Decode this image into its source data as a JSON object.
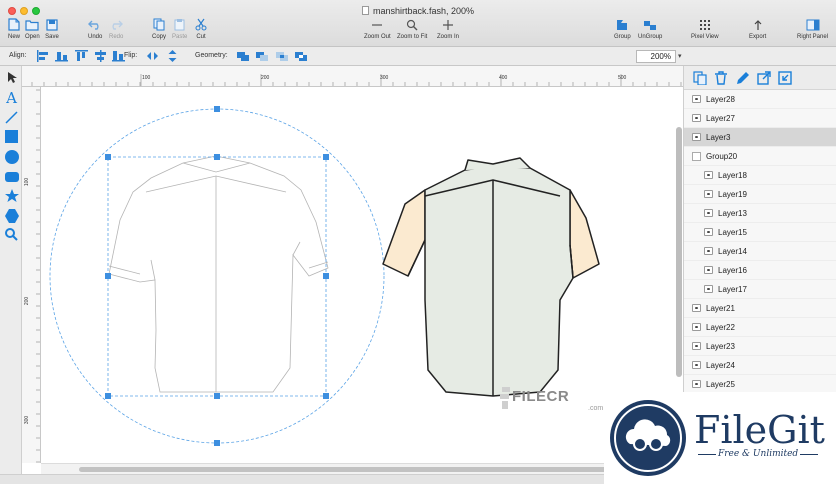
{
  "window": {
    "title": "manshirtback.fash, 200%"
  },
  "toolbar": {
    "new": "New",
    "open": "Open",
    "save": "Save",
    "undo": "Undo",
    "redo": "Redo",
    "copy": "Copy",
    "paste": "Paste",
    "cut": "Cut",
    "zoom_out": "Zoom Out",
    "zoom_to_fit": "Zoom to Fit",
    "zoom_in": "Zoom In",
    "group": "Group",
    "ungroup": "UnGroup",
    "pixel_view": "Pixel View",
    "export": "Export",
    "right_panel": "Right Panel"
  },
  "options": {
    "align_label": "Align:",
    "flip_label": "Flip:",
    "geometry_label": "Geometry:",
    "zoom_value": "200%"
  },
  "rulers": {
    "horizontal": [
      "100",
      "200",
      "300",
      "400",
      "500"
    ],
    "vertical": [
      "100",
      "200",
      "300"
    ]
  },
  "layers": [
    {
      "name": "Layer28",
      "kind": "layer",
      "selected": false
    },
    {
      "name": "Layer27",
      "kind": "layer",
      "selected": false
    },
    {
      "name": "Layer3",
      "kind": "layer",
      "selected": true
    },
    {
      "name": "Group20",
      "kind": "group",
      "selected": false
    },
    {
      "name": "Layer18",
      "kind": "child",
      "selected": false
    },
    {
      "name": "Layer19",
      "kind": "child",
      "selected": false
    },
    {
      "name": "Layer13",
      "kind": "child",
      "selected": false
    },
    {
      "name": "Layer15",
      "kind": "child",
      "selected": false
    },
    {
      "name": "Layer14",
      "kind": "child",
      "selected": false
    },
    {
      "name": "Layer16",
      "kind": "child",
      "selected": false
    },
    {
      "name": "Layer17",
      "kind": "child",
      "selected": false
    },
    {
      "name": "Layer21",
      "kind": "layer",
      "selected": false
    },
    {
      "name": "Layer22",
      "kind": "layer",
      "selected": false
    },
    {
      "name": "Layer23",
      "kind": "layer",
      "selected": false
    },
    {
      "name": "Layer24",
      "kind": "layer",
      "selected": false
    },
    {
      "name": "Layer25",
      "kind": "layer",
      "selected": false
    }
  ],
  "watermarks": {
    "filecr": "FILECR",
    "filecr_suffix": ".com",
    "filegit_title": "FileGit",
    "filegit_subtitle": "Free & Unlimited"
  },
  "colors": {
    "accent": "#1a7fd9",
    "selection": "#3d8fe0",
    "sleeve_fill": "#fbead0",
    "body_fill": "#e6ebe4",
    "brand_navy": "#1f3b63"
  }
}
